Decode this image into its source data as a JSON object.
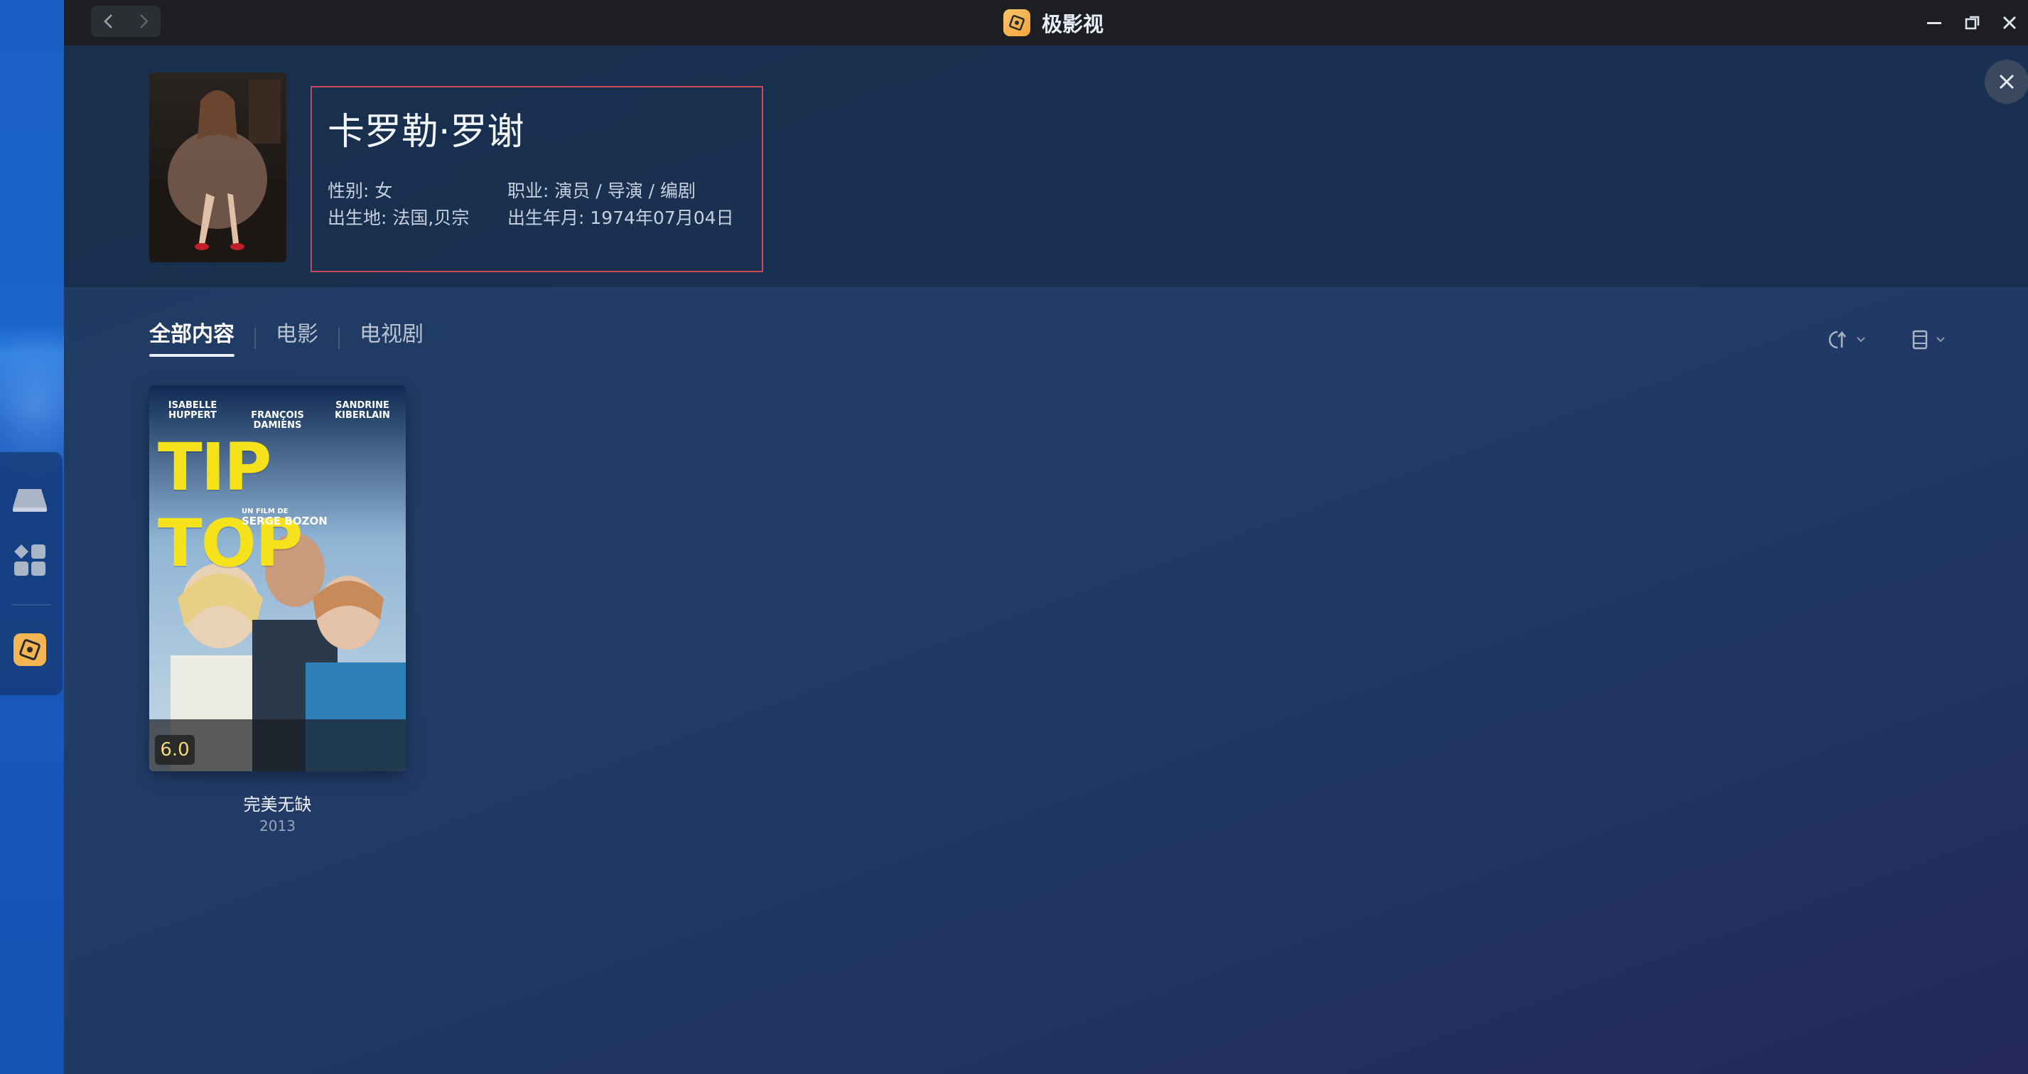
{
  "window": {
    "title": "极影视"
  },
  "person": {
    "name": "卡罗勒·罗谢",
    "gender_label": "性别",
    "gender": "女",
    "occupation_label": "职业",
    "occupation": "演员 / 导演 / 编剧",
    "birthplace_label": "出生地",
    "birthplace": "法国,贝宗",
    "birthdate_label": "出生年月",
    "birthdate": "1974年07月04日"
  },
  "tabs": [
    {
      "label": "全部内容",
      "active": true
    },
    {
      "label": "电影",
      "active": false
    },
    {
      "label": "电视剧",
      "active": false
    }
  ],
  "items": [
    {
      "title": "完美无缺",
      "year": "2013",
      "rating": "6.0",
      "poster": {
        "actors": [
          "ISABELLE HUPPERT",
          "FRANÇOIS DAMIENS",
          "SANDRINE KIBERLAIN"
        ],
        "title": "TIP TOP",
        "director_line": "UN FILM DE",
        "director": "SERGE BOZON"
      }
    }
  ],
  "colors": {
    "accent": "#f0a43c",
    "info_border": "#c94a5a",
    "rating": "#f3d77a"
  },
  "icons": {
    "dock": [
      "storage-icon",
      "apps-grid-icon",
      "media-app-icon"
    ],
    "toolbar": [
      "sort-icon",
      "view-mode-icon"
    ]
  }
}
